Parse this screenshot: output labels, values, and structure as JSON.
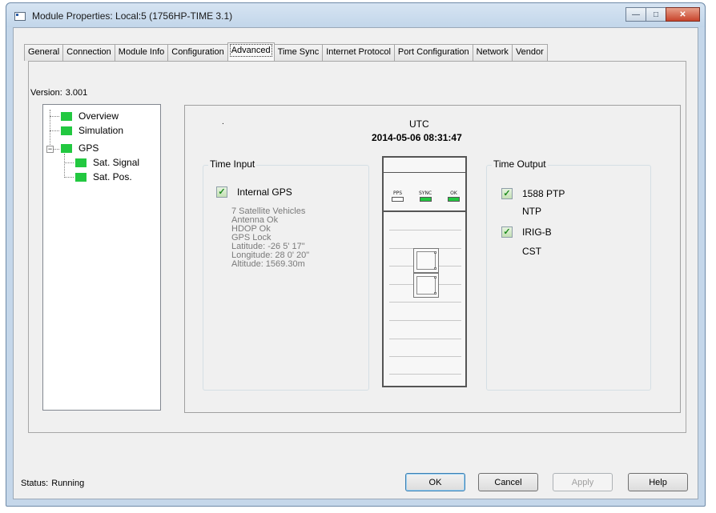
{
  "window": {
    "title": "Module Properties: Local:5 (1756HP-TIME 3.1)"
  },
  "tabs": [
    {
      "label": "General"
    },
    {
      "label": "Connection"
    },
    {
      "label": "Module Info"
    },
    {
      "label": "Configuration"
    },
    {
      "label": "Advanced"
    },
    {
      "label": "Time Sync"
    },
    {
      "label": "Internet Protocol"
    },
    {
      "label": "Port Configuration"
    },
    {
      "label": "Network"
    },
    {
      "label": "Vendor"
    }
  ],
  "active_tab": "Advanced",
  "version": {
    "label": "Version:",
    "value": "3.001"
  },
  "tree": [
    {
      "label": "Overview"
    },
    {
      "label": "Simulation"
    },
    {
      "label": "GPS"
    },
    {
      "label": "Sat. Signal"
    },
    {
      "label": "Sat. Pos."
    }
  ],
  "utc": {
    "label": "UTC",
    "time": "2014-05-06  08:31:47",
    "dot": "."
  },
  "time_input": {
    "title": "Time Input",
    "source": "Internal GPS",
    "checked": true,
    "details": [
      "7 Satellite Vehicles",
      "Antenna Ok",
      "HDOP Ok",
      "GPS Lock",
      "Latitude: -26  5'  17\"",
      "Longitude: 28  0'  20\"",
      "Altitude: 1569.30m"
    ]
  },
  "device": {
    "leds": [
      {
        "label": "PPS",
        "state": "off"
      },
      {
        "label": "SYNC",
        "state": "on"
      },
      {
        "label": "OK",
        "state": "on"
      }
    ],
    "led_on_color": "#22c840"
  },
  "time_output": {
    "title": "Time Output",
    "items": [
      {
        "label": "1588 PTP",
        "checked": true
      },
      {
        "label": "NTP",
        "checked": false
      },
      {
        "label": "IRIG-B",
        "checked": true
      },
      {
        "label": "CST",
        "checked": false
      }
    ]
  },
  "status": {
    "label": "Status:",
    "value": "Running"
  },
  "buttons": {
    "ok": "OK",
    "cancel": "Cancel",
    "apply": "Apply",
    "help": "Help"
  },
  "colors": {
    "window_frame": "#c5d7ea",
    "tree_node": "#22c840",
    "close_button": "#c8442c"
  }
}
